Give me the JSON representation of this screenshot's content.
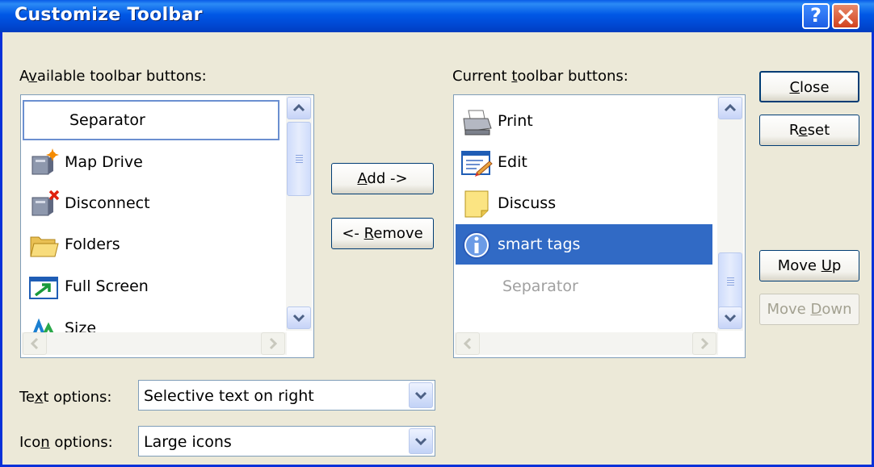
{
  "window": {
    "title": "Customize Toolbar"
  },
  "available": {
    "label_pre": "A",
    "label_u": "v",
    "label_post": "ailable toolbar buttons:",
    "items": [
      {
        "label": "Separator",
        "icon": "separator"
      },
      {
        "label": "Map Drive",
        "icon": "map-drive-icon"
      },
      {
        "label": "Disconnect",
        "icon": "disconnect-icon"
      },
      {
        "label": "Folders",
        "icon": "folders-icon"
      },
      {
        "label": "Full Screen",
        "icon": "full-screen-icon"
      },
      {
        "label": "Size",
        "icon": "size-icon"
      }
    ]
  },
  "current": {
    "label_pre": "Current ",
    "label_u": "t",
    "label_post": "oolbar buttons:",
    "items": [
      {
        "label": "Print",
        "icon": "print-icon"
      },
      {
        "label": "Edit",
        "icon": "edit-icon"
      },
      {
        "label": "Discuss",
        "icon": "discuss-icon"
      },
      {
        "label": "smart tags",
        "icon": "info-icon",
        "selected": true
      },
      {
        "label": "Separator",
        "icon": "separator"
      }
    ]
  },
  "buttons": {
    "add": {
      "u": "A",
      "rest": "dd ->"
    },
    "remove": {
      "pre": "<- ",
      "u": "R",
      "rest": "emove"
    },
    "close": {
      "u": "C",
      "rest": "lose"
    },
    "reset": {
      "pre": "R",
      "u": "e",
      "rest": "set"
    },
    "move_up": {
      "pre": "Move ",
      "u": "U",
      "rest": "p"
    },
    "move_down": {
      "pre": "Move ",
      "u": "D",
      "rest": "own"
    }
  },
  "text_options": {
    "label_pre": "Te",
    "label_u": "x",
    "label_post": "t options:",
    "value": "Selective text on right"
  },
  "icon_options": {
    "label_pre": "Ico",
    "label_u": "n",
    "label_post": " options:",
    "value": "Large icons"
  },
  "colors": {
    "title_bar": "#0054e3",
    "selection": "#316ac5",
    "face": "#ece9d8"
  }
}
